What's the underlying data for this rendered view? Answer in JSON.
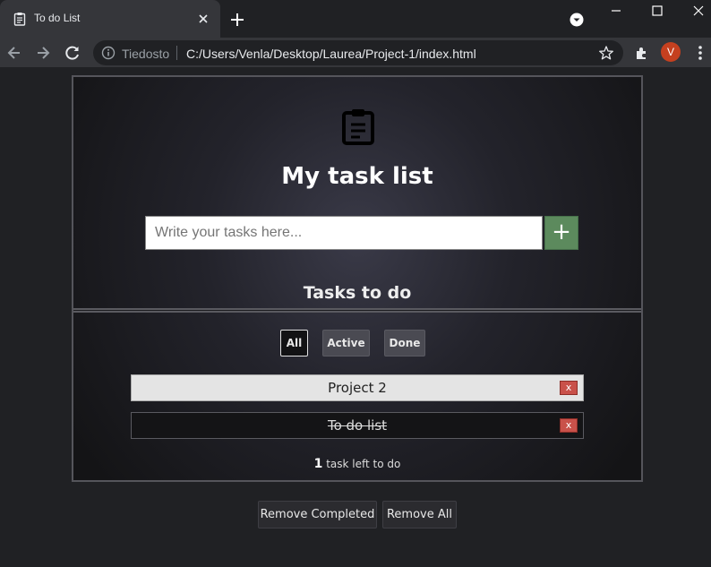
{
  "browser": {
    "tab_title": "To do List",
    "site_label": "Tiedosto",
    "url": "C:/Users/Venla/Desktop/Laurea/Project-1/index.html",
    "avatar_letter": "V"
  },
  "app": {
    "title": "My task list",
    "input_placeholder": "Write your tasks here...",
    "add_button": "+",
    "section_heading": "Tasks to do",
    "filters": [
      {
        "label": "All",
        "selected": true
      },
      {
        "label": "Active",
        "selected": false
      },
      {
        "label": "Done",
        "selected": false
      }
    ],
    "tasks": [
      {
        "text": "Project 2",
        "completed": false,
        "delete_label": "x"
      },
      {
        "text": "To do list",
        "completed": true,
        "delete_label": "x"
      }
    ],
    "counter": {
      "count": "1",
      "suffix": "task left to do"
    },
    "remove_completed": "Remove Completed",
    "remove_all": "Remove All"
  },
  "colors": {
    "add_button": "#5c8a5d",
    "delete_button": "#c9514a",
    "avatar": "#c5401f"
  }
}
